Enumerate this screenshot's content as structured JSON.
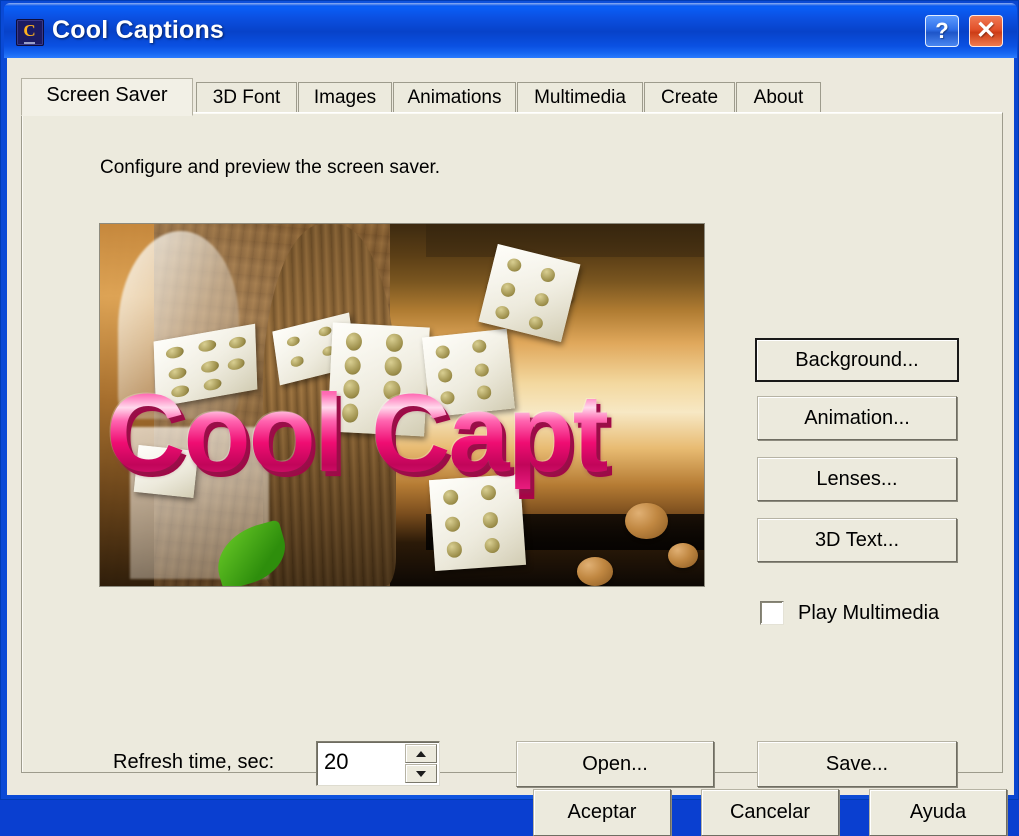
{
  "window": {
    "title": "Cool Captions",
    "icon": "app-monitor-c-icon",
    "icon_letter": "C",
    "controls": [
      {
        "name": "help-button",
        "glyph": "?"
      },
      {
        "name": "close-button",
        "glyph": "✕"
      }
    ],
    "colors": {
      "titlebar_blue": "#0b4fe0",
      "dialog_face": "#ece9dd",
      "close_red": "#e2512a",
      "help_blue": "#2f6fe8"
    }
  },
  "tabs": {
    "selected_index": 0,
    "items": [
      {
        "label": "Screen Saver"
      },
      {
        "label": "3D Font"
      },
      {
        "label": "Images"
      },
      {
        "label": "Animations"
      },
      {
        "label": "Multimedia"
      },
      {
        "label": "Create"
      },
      {
        "label": "About"
      }
    ]
  },
  "page": {
    "hint": "Configure and preview the screen saver.",
    "preview": {
      "name": "screen-saver-preview",
      "caption_text": "Cool Capt",
      "description": "Preview render: warm brown stone and amber gradient background with scattered white dice and large pink 3D caption text, clipped at the right edge."
    },
    "actions": [
      {
        "label": "Background...",
        "name": "background-button",
        "default": true
      },
      {
        "label": "Animation...",
        "name": "animation-button",
        "default": false
      },
      {
        "label": "Lenses...",
        "name": "lenses-button",
        "default": false
      },
      {
        "label": "3D Text...",
        "name": "3d-text-button",
        "default": false
      }
    ],
    "play_multimedia": {
      "label": "Play Multimedia",
      "checked": false
    },
    "refresh": {
      "label": "Refresh time, sec:",
      "value": "20"
    },
    "file_actions": [
      {
        "label": "Open...",
        "name": "open-button"
      },
      {
        "label": "Save...",
        "name": "save-button"
      }
    ]
  },
  "dialog_buttons": [
    {
      "label": "Aceptar",
      "name": "accept-button"
    },
    {
      "label": "Cancelar",
      "name": "cancel-button"
    },
    {
      "label": "Ayuda",
      "name": "help-dialog-button"
    }
  ]
}
